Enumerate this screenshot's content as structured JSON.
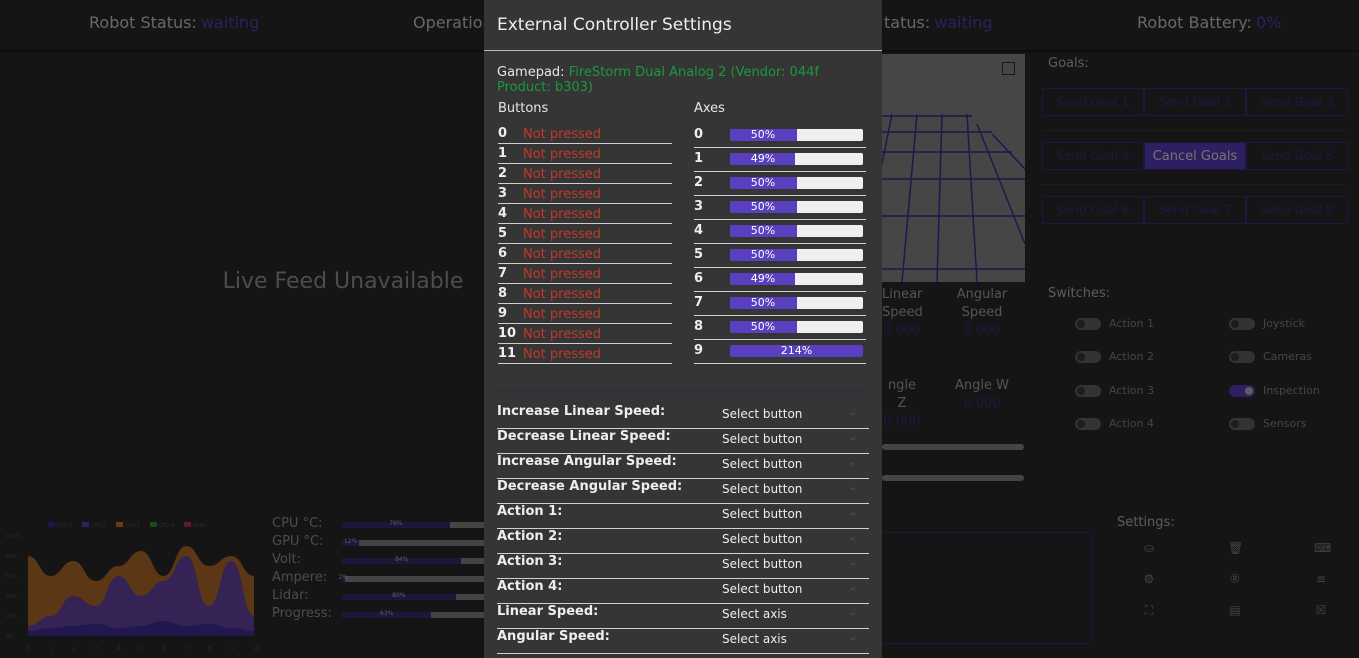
{
  "topbar": {
    "robot_status_label": "Robot Status:",
    "robot_status_value": "waiting",
    "operation_label": "Operatio",
    "status2_label": "tatus:",
    "status2_value": "waiting",
    "battery_label": "Robot Battery:",
    "battery_value": "0%"
  },
  "live_feed": {
    "text": "Live Feed Unavailable"
  },
  "goals": {
    "title": "Goals:",
    "rows": [
      [
        "Send Goal 1",
        "Send Goal 2",
        "Send Goal 3"
      ],
      [
        "Send Goal 4",
        "Cancel Goals",
        "Send Goal 5"
      ],
      [
        "Send Goal 6",
        "Send Goal 7",
        "Send Goal 8"
      ]
    ]
  },
  "speeds": {
    "linear_label_1": "Linear",
    "linear_label_2": "Speed",
    "linear_value": "0.000",
    "angular_label_1": "Angular",
    "angular_label_2": "Speed",
    "angular_value": "0.000",
    "angle_z_label": "ngle Z",
    "angle_z_value": "0.000",
    "angle_w_label": "Angle W",
    "angle_w_value": "0.000"
  },
  "switches": {
    "title": "Switches:",
    "items": [
      {
        "label": "Action 1",
        "on": false
      },
      {
        "label": "Joystick",
        "on": false
      },
      {
        "label": "Action 2",
        "on": false
      },
      {
        "label": "Cameras",
        "on": false
      },
      {
        "label": "Action 3",
        "on": false
      },
      {
        "label": "Inspection",
        "on": true
      },
      {
        "label": "Action 4",
        "on": false
      },
      {
        "label": "Sensors",
        "on": false
      }
    ]
  },
  "metrics": {
    "items": [
      {
        "label": "CPU °C:",
        "value": "76%",
        "fraction": 0.76
      },
      {
        "label": "GPU °C:",
        "value": "12%",
        "fraction": 0.12
      },
      {
        "label": "Volt:",
        "value": "84%",
        "fraction": 0.84
      },
      {
        "label": "Ampere:",
        "value": "2%",
        "fraction": 0.02
      },
      {
        "label": "Lidar:",
        "value": "80%",
        "fraction": 0.8
      },
      {
        "label": "Progress:",
        "value": "63%",
        "fraction": 0.63
      }
    ]
  },
  "chart_data": {
    "type": "area",
    "legend": [
      "CPU 1",
      "CPU 2",
      "CPU 3",
      "CPU 4",
      "RAM"
    ],
    "yticks": [
      "100%",
      "80%",
      "60%",
      "40%",
      "20%",
      "0%"
    ],
    "xticks": [
      "0",
      "1",
      "2",
      "3",
      "4",
      "5",
      "6",
      "7",
      "8",
      "9",
      "10"
    ],
    "colors": [
      "#3a2d9a",
      "#5a3fc0",
      "#d07a2a",
      "#2e9a3a",
      "#c0306a"
    ],
    "series": [
      {
        "name": "CPU 1",
        "values": [
          5,
          8,
          10,
          12,
          8,
          10,
          15,
          10,
          12,
          8,
          5
        ]
      },
      {
        "name": "CPU 2",
        "values": [
          10,
          20,
          40,
          30,
          60,
          40,
          55,
          80,
          30,
          75,
          20
        ]
      },
      {
        "name": "CPU 3",
        "values": [
          80,
          60,
          75,
          55,
          70,
          85,
          60,
          90,
          70,
          80,
          60
        ]
      },
      {
        "name": "CPU 4",
        "values": [
          0,
          0,
          0,
          0,
          0,
          0,
          0,
          0,
          0,
          0,
          0
        ]
      },
      {
        "name": "RAM",
        "values": [
          0,
          0,
          0,
          0,
          0,
          0,
          0,
          0,
          0,
          0,
          0
        ]
      }
    ],
    "ylim": [
      0,
      100
    ]
  },
  "settings": {
    "title": "Settings:",
    "icons": [
      "joystick-icon",
      "trash-icon",
      "keyboard-icon",
      "gear-icon",
      "registered-icon",
      "sliders-icon",
      "fullscreen-icon",
      "archive-icon",
      "close-box-icon"
    ],
    "glyphs": [
      "⛀",
      "🗑",
      "⌨",
      "⚙",
      "®",
      "≡",
      "⛶",
      "▤",
      "☒"
    ]
  },
  "modal": {
    "title": "External Controller Settings",
    "gamepad_label": "Gamepad:",
    "gamepad_value": "FireStorm Dual Analog 2 (Vendor: 044f Product: b303)",
    "buttons_header": "Buttons",
    "axes_header": "Axes",
    "buttons": [
      {
        "num": "0",
        "state": "Not pressed"
      },
      {
        "num": "1",
        "state": "Not pressed"
      },
      {
        "num": "2",
        "state": "Not pressed"
      },
      {
        "num": "3",
        "state": "Not pressed"
      },
      {
        "num": "4",
        "state": "Not pressed"
      },
      {
        "num": "5",
        "state": "Not pressed"
      },
      {
        "num": "6",
        "state": "Not pressed"
      },
      {
        "num": "7",
        "state": "Not pressed"
      },
      {
        "num": "8",
        "state": "Not pressed"
      },
      {
        "num": "9",
        "state": "Not pressed"
      },
      {
        "num": "10",
        "state": "Not pressed"
      },
      {
        "num": "11",
        "state": "Not pressed"
      }
    ],
    "axes": [
      {
        "num": "0",
        "value": "50%",
        "fraction": 0.5
      },
      {
        "num": "1",
        "value": "49%",
        "fraction": 0.49
      },
      {
        "num": "2",
        "value": "50%",
        "fraction": 0.5
      },
      {
        "num": "3",
        "value": "50%",
        "fraction": 0.5
      },
      {
        "num": "4",
        "value": "50%",
        "fraction": 0.5
      },
      {
        "num": "5",
        "value": "50%",
        "fraction": 0.5
      },
      {
        "num": "6",
        "value": "49%",
        "fraction": 0.49
      },
      {
        "num": "7",
        "value": "50%",
        "fraction": 0.5
      },
      {
        "num": "8",
        "value": "50%",
        "fraction": 0.5
      },
      {
        "num": "9",
        "value": "214%",
        "fraction": 2.14
      }
    ],
    "mappings": [
      {
        "label": "Increase Linear Speed:",
        "select": "Select button"
      },
      {
        "label": "Decrease Linear Speed:",
        "select": "Select button"
      },
      {
        "label": "Increase Angular Speed:",
        "select": "Select button"
      },
      {
        "label": "Decrease Angular Speed:",
        "select": "Select button"
      },
      {
        "label": "Action 1:",
        "select": "Select button"
      },
      {
        "label": "Action 2:",
        "select": "Select button"
      },
      {
        "label": "Action 3:",
        "select": "Select button"
      },
      {
        "label": "Action 4:",
        "select": "Select button"
      },
      {
        "label": "Linear Speed:",
        "select": "Select axis"
      },
      {
        "label": "Angular Speed:",
        "select": "Select axis"
      }
    ]
  }
}
